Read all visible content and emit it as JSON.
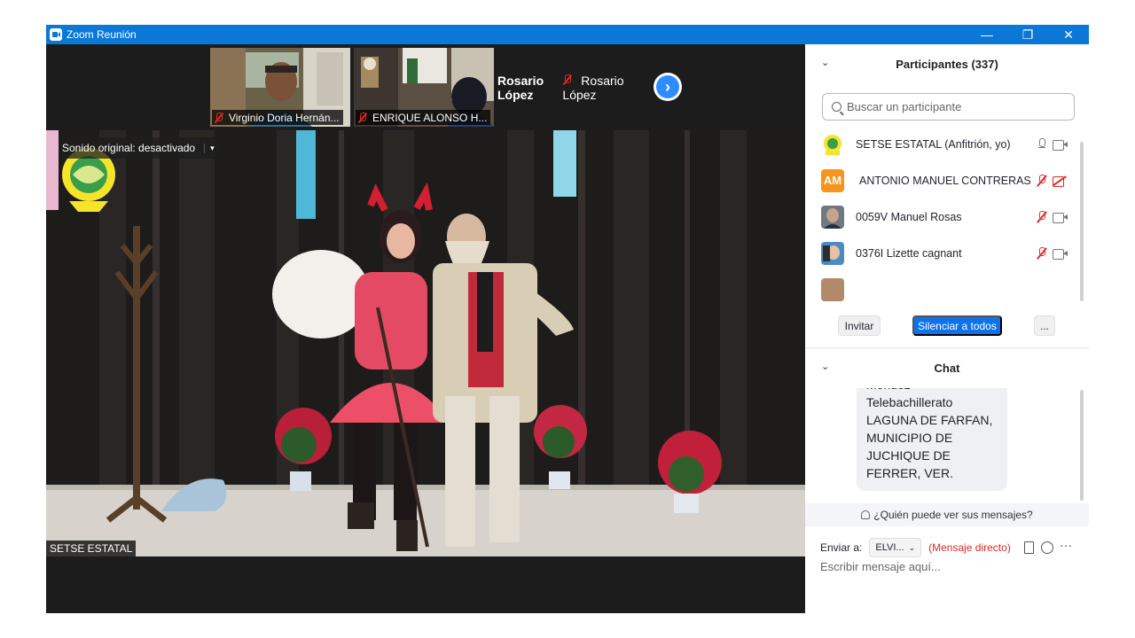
{
  "window": {
    "title": "Zoom Reunión",
    "controls": [
      "—",
      "❐",
      "✕"
    ]
  },
  "video_strip": {
    "tiles": [
      {
        "name": "Virginio Doria Hernán...",
        "muted": true
      },
      {
        "name": "ENRIQUE ALONSO H...",
        "muted": true
      },
      {
        "name": "Rosario López",
        "muted": true,
        "display_text": "Rosario López"
      }
    ],
    "next_icon": "chevron-right-icon"
  },
  "main_video": {
    "original_sound": "Sonido original: desactivado",
    "caret": "▾",
    "speaker_label": "SETSE ESTATAL"
  },
  "participants": {
    "chevron": "⌄",
    "title": "Participantes (337)",
    "search_placeholder": "Buscar un participante",
    "list": [
      {
        "name": "SETSE ESTATAL (Anfitrión, yo)",
        "mic": "on",
        "camera": "on",
        "avatar": "logo"
      },
      {
        "name": "ANTONIO MANUEL CONTRERAS",
        "mic": "muted",
        "camera": "off",
        "avatar": "AM"
      },
      {
        "name": "0059V Manuel Rosas",
        "mic": "muted",
        "camera": "on",
        "avatar": "photo"
      },
      {
        "name": "0376I Lizette cagnant",
        "mic": "muted",
        "camera": "on",
        "avatar": "photo"
      }
    ],
    "buttons": {
      "invite": "Invitar",
      "mute_all": "Silenciar a todos",
      "more": "..."
    }
  },
  "chat": {
    "chevron": "⌄",
    "title": "Chat",
    "message": "Mendez\nTelebachillerato LAGUNA DE FARFAN, MUNICIPIO DE JUCHIQUE DE FERRER, VER.",
    "who_can_see": "¿Quién puede ver sus mensajes?",
    "send_to_label": "Enviar a:",
    "send_to_value": "ELVI...",
    "send_to_caret": "⌄",
    "direct_message": "(Mensaje directo)",
    "more": "···",
    "compose_placeholder": "Escribir mensaje aquí..."
  },
  "colors": {
    "accent": "#0e72ed",
    "titlebar": "#0b78d7",
    "muted": "#e02828"
  }
}
